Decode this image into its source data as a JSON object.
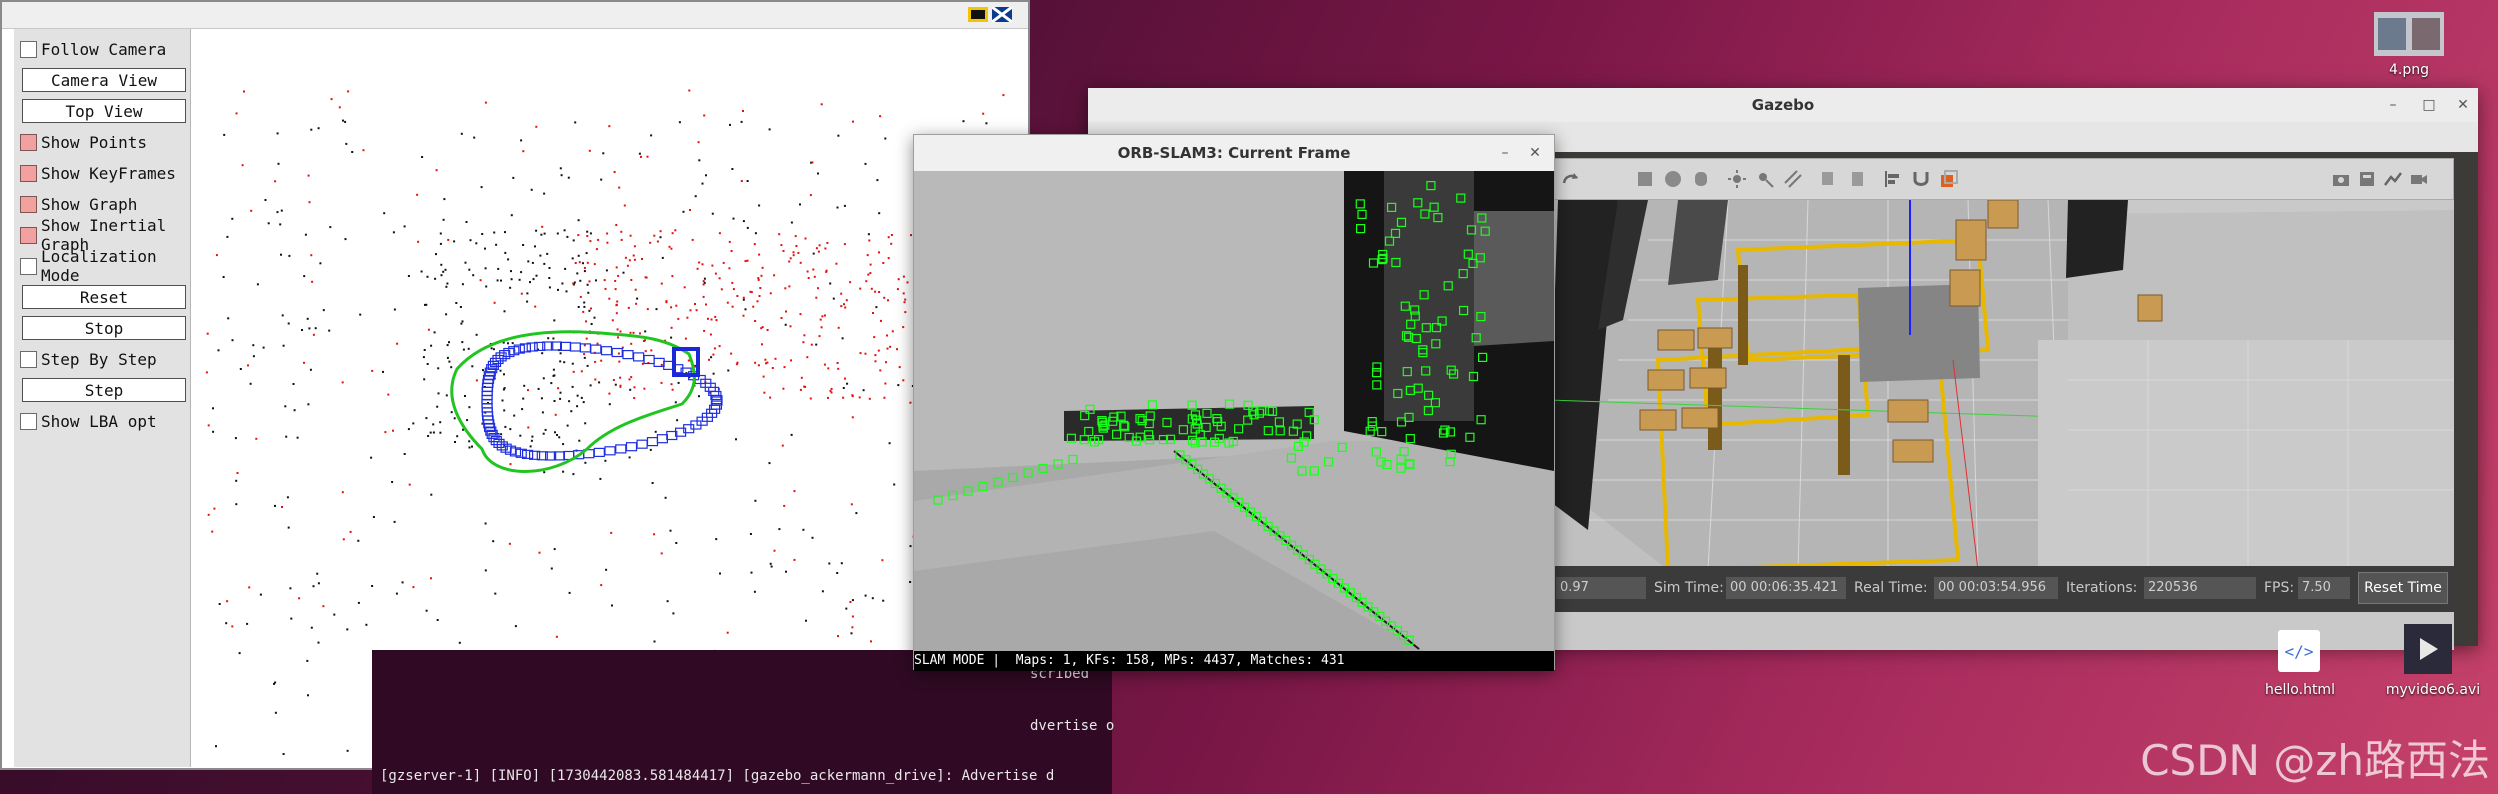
{
  "desktop": {
    "icons": [
      {
        "label": "4.png"
      },
      {
        "label": "hello.html"
      },
      {
        "label": "myvideo6.avi"
      }
    ],
    "watermark": "CSDN @zh路西法"
  },
  "pangolin": {
    "controls": [
      {
        "type": "checkbox",
        "label": "Follow Camera",
        "checked": false
      },
      {
        "type": "button",
        "label": "Camera View"
      },
      {
        "type": "button",
        "label": "Top View"
      },
      {
        "type": "checkbox",
        "label": "Show Points",
        "checked": true
      },
      {
        "type": "checkbox",
        "label": "Show KeyFrames",
        "checked": true
      },
      {
        "type": "checkbox",
        "label": "Show Graph",
        "checked": true
      },
      {
        "type": "checkbox",
        "label": "Show Inertial Graph",
        "checked": true
      },
      {
        "type": "checkbox",
        "label": "Localization Mode",
        "checked": false
      },
      {
        "type": "button",
        "label": "Reset"
      },
      {
        "type": "button",
        "label": "Stop"
      },
      {
        "type": "checkbox",
        "label": "Step By Step",
        "checked": false
      },
      {
        "type": "button",
        "label": "Step"
      },
      {
        "type": "checkbox",
        "label": "Show LBA opt",
        "checked": false
      }
    ]
  },
  "terminal": {
    "lines": [
      "scribed",
      "dvertise o",
      "[gzserver-1] [INFO] [1730442083.581484417] [gazebo_ackermann_drive]: Advertise d"
    ]
  },
  "gazebo": {
    "title": "Gazebo",
    "status": {
      "rtf": "0.97",
      "sim_time_label": "Sim Time:",
      "sim_time": "00 00:06:35.421",
      "real_time_label": "Real Time:",
      "real_time": "00 00:03:54.956",
      "iterations_label": "Iterations:",
      "iterations": "220536",
      "fps_label": "FPS:",
      "fps": "7.50",
      "reset_label": "Reset Time"
    }
  },
  "orb": {
    "title": "ORB-SLAM3: Current Frame",
    "info": "SLAM MODE |  Maps: 1, KFs: 158, MPs: 4437, Matches: 431"
  },
  "colors": {
    "points_red": "#e41010",
    "keyframes_blue": "#1f2fe0",
    "graph_green": "#22c422",
    "feature_green": "#19ff19"
  }
}
